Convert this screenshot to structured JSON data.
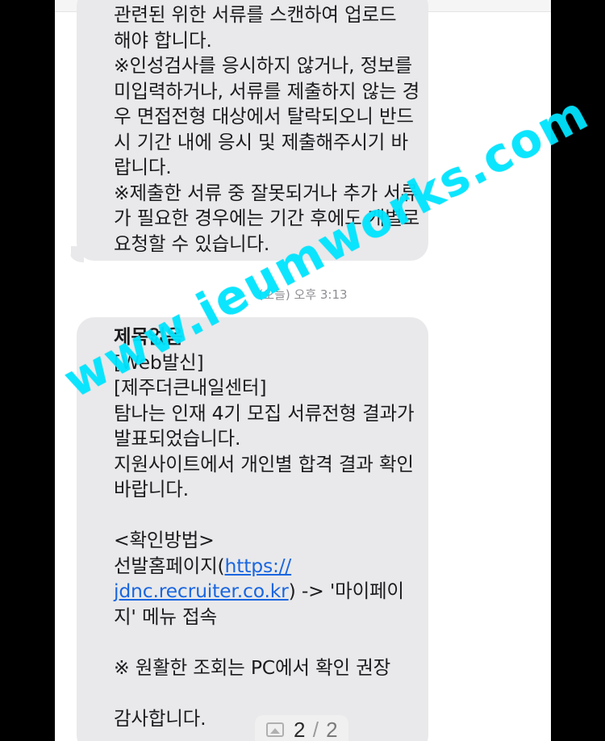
{
  "message_1": {
    "cut_top_line": "관련된 위한 서류를 스캔하여 업로드",
    "lines": [
      "해야 합니다.",
      "※인성검사를 응시하지 않거나, 정보를",
      "미입력하거나, 서류를 제출하지 않는 경",
      "우 면접전형 대상에서 탈락되오니 반드",
      "시 기간 내에 응시 및 제출해주시기 바",
      "랍니다.",
      "※제출한 서류 중 잘못되거나 추가 서류",
      "가 필요한 경우에는 기간 후에도 개별로",
      "요청할 수 있습니다."
    ]
  },
  "timestamp": {
    "day": "(오늘)",
    "time": "오후 3:13"
  },
  "message_2": {
    "subject": "제목없음",
    "line_web": "[Web발신]",
    "line_sender": "[제주더큰내일센터]",
    "line_1": "탐나는 인재 4기 모집 서류전형 결과가",
    "line_2": "발표되었습니다.",
    "line_3": "지원사이트에서 개인별 합격 결과 확인",
    "line_4": "바랍니다.",
    "line_method": "<확인방법>",
    "home_prefix": "선발홈페이지(",
    "link_part1": "https://",
    "link_part2": "jdnc.recruiter.co.kr",
    "home_suffix": ") -> '마이페이",
    "home_end": "지' 메뉴 접속",
    "notice": "※ 원활한 조회는 PC에서 확인 권장",
    "closing": "감사합니다."
  },
  "watermark": "www.ieumworks.com",
  "pager": {
    "current": "2",
    "separator": "/",
    "total": "2",
    "icon": "image-icon"
  },
  "colors": {
    "bubble": "#e9e9eb",
    "link": "#1a66e0",
    "watermark": "#00e6ff",
    "background": "#000000"
  }
}
